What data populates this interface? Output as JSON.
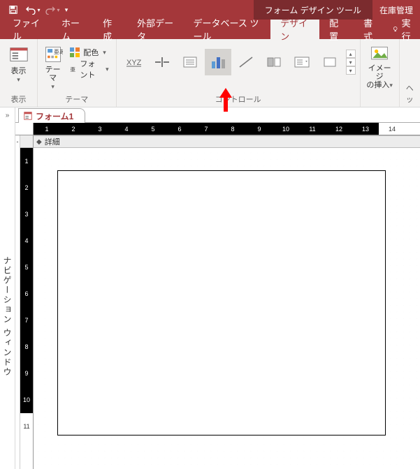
{
  "qat": {
    "save_icon": "save",
    "undo_icon": "undo",
    "redo_icon": "redo"
  },
  "title": {
    "context_tab": "フォーム デザイン ツール",
    "right": "在庫管理"
  },
  "tabs": {
    "file": "ファイル",
    "home": "ホーム",
    "create": "作成",
    "external": "外部データ",
    "dbtools": "データベース ツール",
    "design": "デザイン",
    "arrange": "配置",
    "format": "書式",
    "help": "実行"
  },
  "ribbon": {
    "views_group": "表示",
    "views_btn": "表示",
    "themes_group": "テーマ",
    "themes_btn": "テーマ",
    "colors_btn": "配色",
    "fonts_btn": "フォント",
    "controls_group": "コントロール",
    "image_group": "ヘッ",
    "image_btn_l1": "イメージ",
    "image_btn_l2": "の挿入"
  },
  "nav_pane_label": "ナビゲーション ウィンドウ",
  "doc_tab": "フォーム1",
  "section_label": "詳細",
  "hruler_numbers": [
    "1",
    "2",
    "3",
    "4",
    "5",
    "6",
    "7",
    "8",
    "9",
    "10",
    "11",
    "12",
    "13",
    "14"
  ],
  "vruler_numbers": [
    "1",
    "2",
    "3",
    "4",
    "5",
    "6",
    "7",
    "8",
    "9",
    "10",
    "11"
  ]
}
